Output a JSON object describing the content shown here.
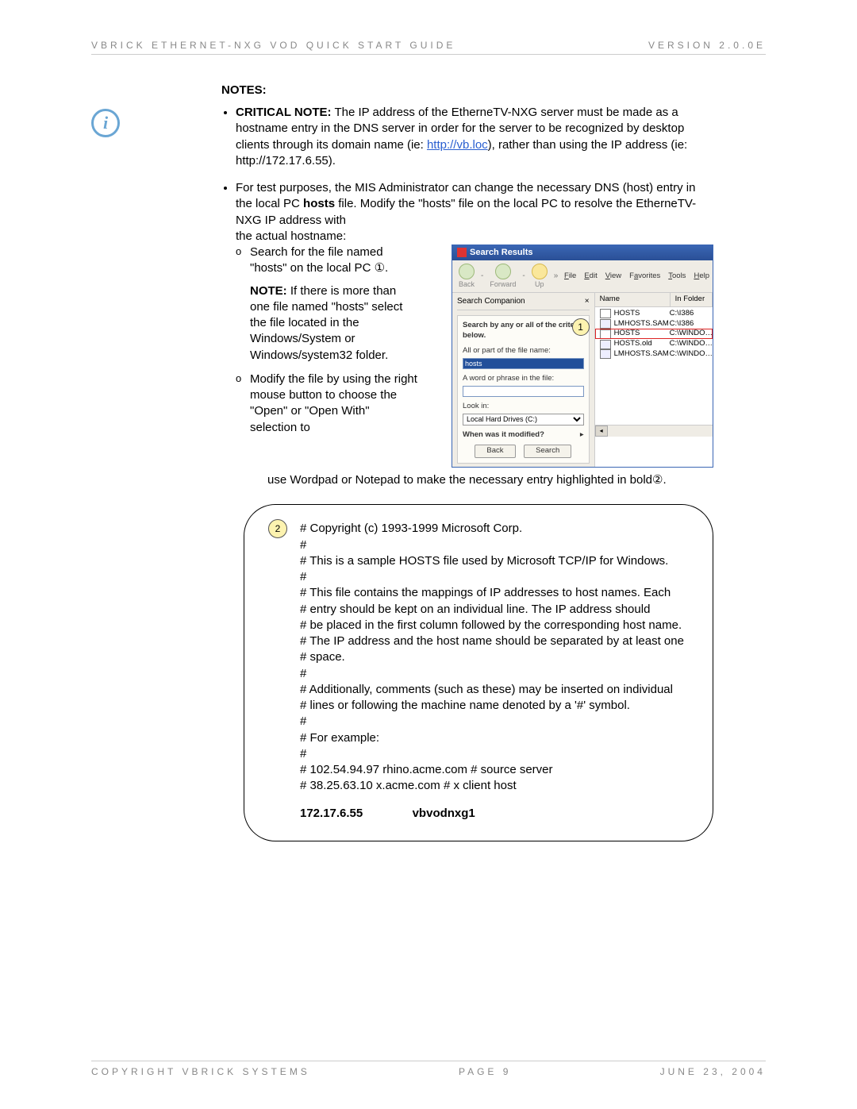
{
  "header": {
    "left": "VBRICK ETHERNET-NXG VOD QUICK START GUIDE",
    "right": "VERSION 2.0.0E"
  },
  "notes_heading": "NOTES:",
  "bullet1": {
    "lead": "CRITICAL NOTE:",
    "text_a": " The IP address of the EtherneTV-NXG server must be made as a hostname entry in the DNS server in order for the server to be recognized by desktop clients through its domain name (ie: ",
    "link": "http://vb.loc",
    "text_b": "), rather than using the IP address (ie: http://172.17.6.55)."
  },
  "bullet2": {
    "line1a": "For test purposes, the MIS Administrator can change the necessary DNS (host) entry in the local PC ",
    "bold1": "hosts",
    "line1b": " file. Modify the \"hosts\" file on the local PC to resolve the EtherneTV-NXG IP address with",
    "line2": "the actual hostname:",
    "sub1": "Search for the file named \"hosts\" on the local PC ①.",
    "sub_note_lead": "NOTE:",
    "sub_note_text": "  If there is more than one file named \"hosts\" select the file located in the Windows/System or Windows/system32 folder.",
    "sub2": "Modify the file by using the right mouse button to choose the \"Open\" or \"Open With\" selection to",
    "after_float": "use Wordpad or Notepad to make the necessary entry highlighted in bold②."
  },
  "search_window": {
    "title": "Search Results",
    "nav": {
      "back": "Back",
      "forward": "Forward",
      "up": "Up"
    },
    "chevrons": "»",
    "menus": [
      "File",
      "Edit",
      "View",
      "Favorites",
      "Tools",
      "Help"
    ],
    "companion_header": "Search Companion",
    "close_x": "×",
    "criteria_label": "Search by any or all of the criteria below.",
    "name_label": "All or part of the file name:",
    "name_value": "hosts",
    "phrase_label": "A word or phrase in the file:",
    "lookin_label": "Look in:",
    "lookin_value": "Local Hard Drives (C:)",
    "modified_label": "When was it modified?",
    "back_btn": "Back",
    "search_btn": "Search",
    "cols": {
      "name": "Name",
      "folder": "In Folder"
    },
    "rows": [
      {
        "name": "HOSTS",
        "folder": "C:\\I386"
      },
      {
        "name": "LMHOSTS.SAM",
        "folder": "C:\\I386"
      },
      {
        "name": "HOSTS",
        "folder": "C:\\WINDO…",
        "highlight": true
      },
      {
        "name": "HOSTS.old",
        "folder": "C:\\WINDO…"
      },
      {
        "name": "LMHOSTS.SAM",
        "folder": "C:\\WINDO…"
      }
    ],
    "callout1": "1"
  },
  "bubble": {
    "callout2": "2",
    "lines": [
      "# Copyright (c) 1993-1999 Microsoft Corp.",
      "#",
      "# This is a sample HOSTS file used by Microsoft TCP/IP for Windows.",
      "#",
      "# This file contains the mappings of IP addresses to host names. Each",
      "# entry should be kept on an individual line. The IP address should",
      "# be placed in the first column followed by the corresponding host name.",
      "# The IP address and the host name should be separated by at least one",
      "# space.",
      "#",
      "# Additionally, comments (such as these) may be inserted on individual",
      "# lines or following the machine name denoted by a '#' symbol.",
      "#",
      "# For example:",
      "#",
      "#      102.54.94.97     rhino.acme.com          # source server",
      "#       38.25.63.10     x.acme.com              # x client host"
    ],
    "bold_ip": "172.17.6.55",
    "bold_host": "vbvodnxg1"
  },
  "footer": {
    "left": "COPYRIGHT VBRICK SYSTEMS",
    "center": "PAGE 9",
    "right": "JUNE 23, 2004"
  }
}
